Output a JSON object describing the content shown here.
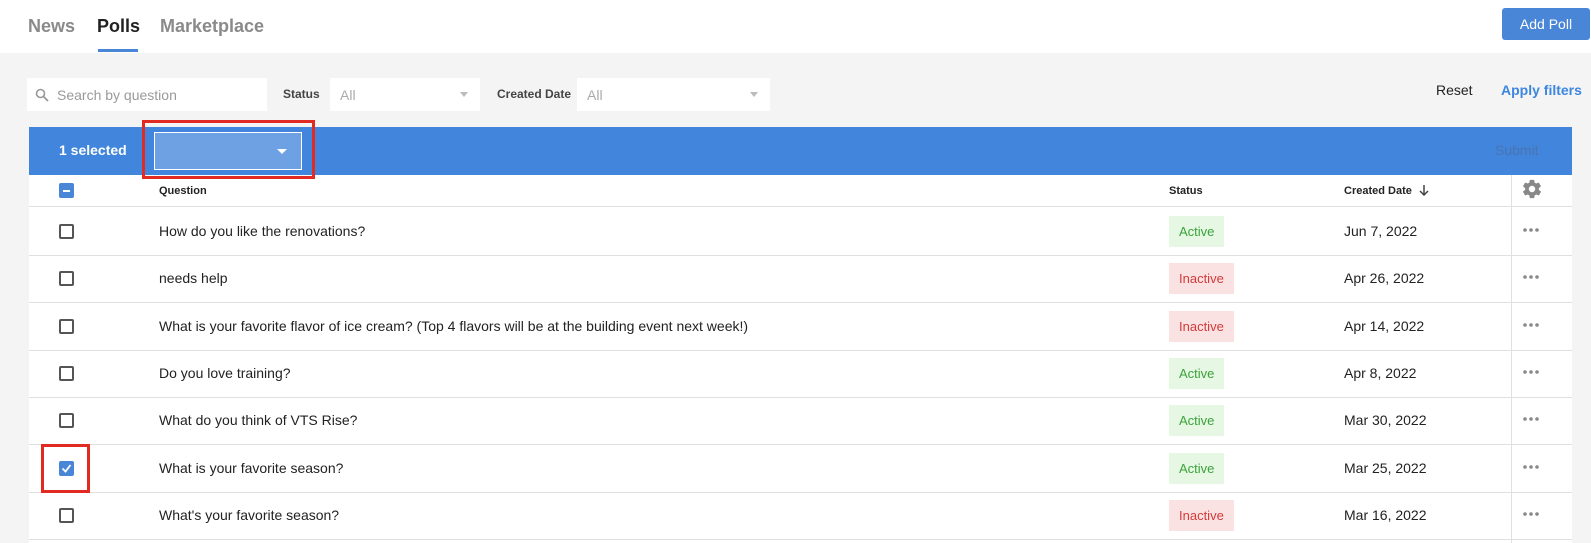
{
  "nav": {
    "tabs": [
      {
        "label": "News",
        "active": false
      },
      {
        "label": "Polls",
        "active": true
      },
      {
        "label": "Marketplace",
        "active": false
      }
    ],
    "add_button": "Add Poll"
  },
  "filters": {
    "search_placeholder": "Search by question",
    "status_label": "Status",
    "status_value": "All",
    "date_label": "Created Date",
    "date_value": "All",
    "reset": "Reset",
    "apply": "Apply filters"
  },
  "bulk": {
    "selected_text": "1 selected",
    "action_value": "",
    "submit": "Submit"
  },
  "table": {
    "columns": {
      "question": "Question",
      "status": "Status",
      "created": "Created Date"
    },
    "rows": [
      {
        "question": "How do you like the renovations?",
        "status": "Active",
        "date": "Jun 7, 2022",
        "checked": false
      },
      {
        "question": "needs help",
        "status": "Inactive",
        "date": "Apr 26, 2022",
        "checked": false
      },
      {
        "question": "What is your favorite flavor of ice cream? (Top 4 flavors will be at the building event next week!)",
        "status": "Inactive",
        "date": "Apr 14, 2022",
        "checked": false
      },
      {
        "question": "Do you love training?",
        "status": "Active",
        "date": "Apr 8, 2022",
        "checked": false
      },
      {
        "question": "What do you think of VTS Rise?",
        "status": "Active",
        "date": "Mar 30, 2022",
        "checked": false
      },
      {
        "question": "What is your favorite season?",
        "status": "Active",
        "date": "Mar 25, 2022",
        "checked": true
      },
      {
        "question": "What's your favorite season?",
        "status": "Inactive",
        "date": "Mar 16, 2022",
        "checked": false
      }
    ]
  },
  "colors": {
    "accent": "#4185dc",
    "active_bg": "#e6f7e3",
    "inactive_bg": "#fbe2e2",
    "highlight": "#e12b22"
  }
}
